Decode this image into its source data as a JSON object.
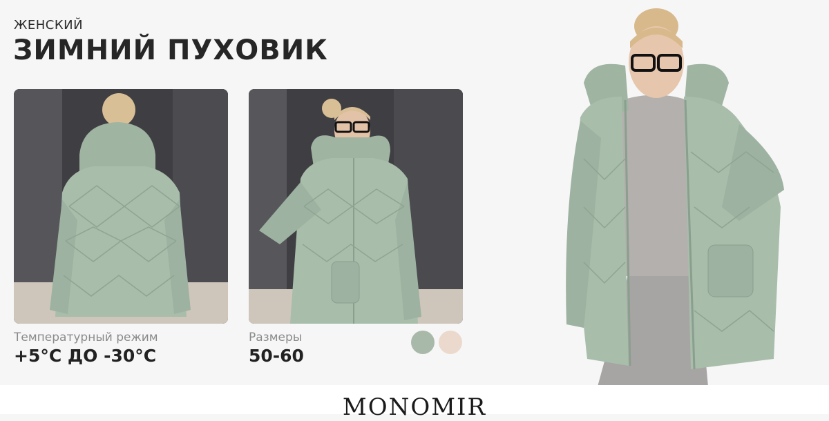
{
  "header": {
    "subtitle": "ЖЕНСКИЙ",
    "title": "ЗИМНИЙ ПУХОВИК"
  },
  "specs": {
    "temperature": {
      "label": "Температурный режим",
      "value": "+5°C ДО -30°C"
    },
    "sizes": {
      "label": "Размеры",
      "value": "50-60"
    }
  },
  "colors": {
    "swatch_sage": "#a9b9a9",
    "swatch_beige": "#ecd9cd",
    "jacket": "#a8bdaa",
    "background": "#f6f6f6"
  },
  "footer": {
    "brand": "MONOMIR"
  }
}
